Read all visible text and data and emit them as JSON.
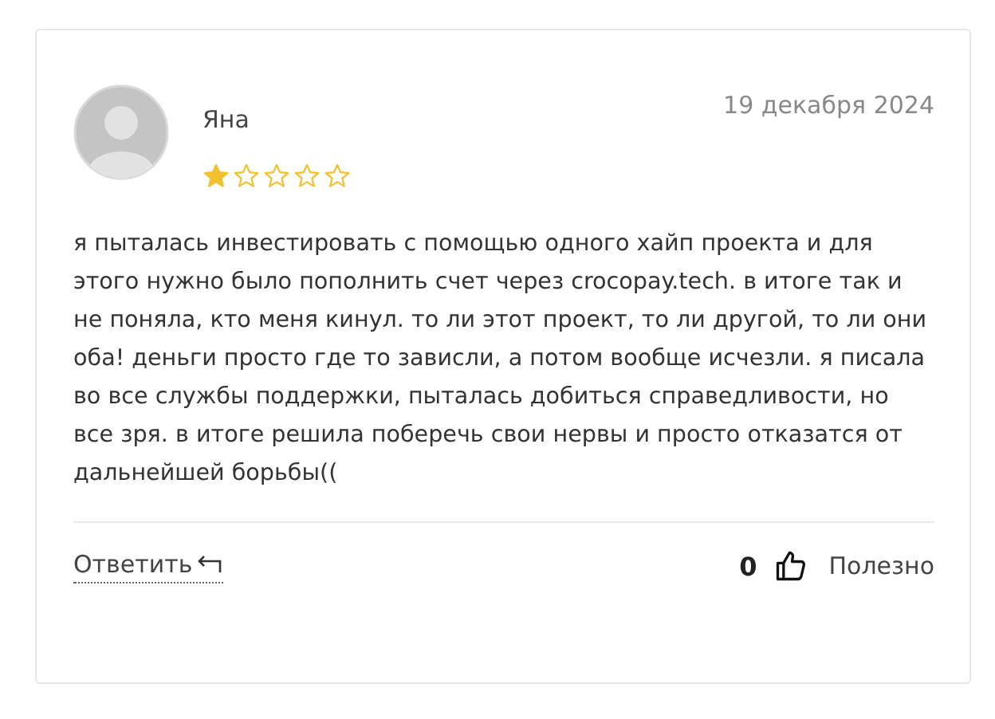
{
  "review": {
    "author": "Яна",
    "date": "19 декабря 2024",
    "stars": 1,
    "text": "я пыталась инвестировать с помощью одного хайп проекта и для этого нужно было пополнить счет через crocopay.tech. в итоге так и не поняла, кто меня кинул. то ли этот проект, то ли другой, то ли они оба! деньги просто где то зависли, а потом вообще исчезли. я писала во все службы поддержки, пыталась добиться справедливости, но все зря. в итоге решила поберечь свои нервы и просто отказатся от дальнейшей борьбы((",
    "reply": "Ответить",
    "likes": "0",
    "helpful": "Полезно"
  }
}
